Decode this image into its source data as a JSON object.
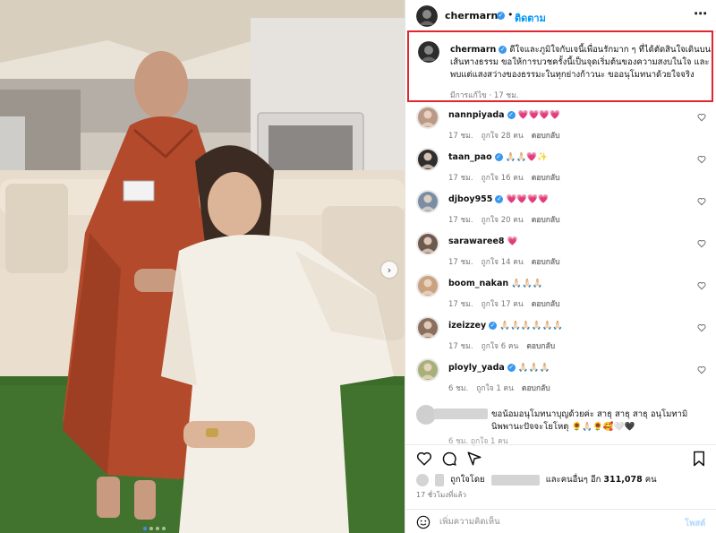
{
  "header": {
    "username": "chermarn",
    "separator": "•",
    "follow_label": "ติดตาม",
    "more_label": "⋯"
  },
  "caption": {
    "username": "chermarn",
    "text": "ดีใจและภูมิใจกับเจนี้เพื่อนรักมาก ๆ ที่ได้ตัดสินใจเดินบนเส้นทางธรรม ขอให้การบวชครั้งนี้เป็นจุดเริ่มต้นของความสงบในใจ และพบแต่แสงสว่างของธรรมะในทุกย่างก้าวนะ ขออนุโมทนาด้วยใจจริง",
    "meta": "มีการแก้ไข · 17 ชม."
  },
  "comments": [
    {
      "username": "nannpiyada",
      "verified": true,
      "text": "💗💗💗💗",
      "time": "17 ชม.",
      "likes": "ถูกใจ 28 คน",
      "reply": "ตอบกลับ",
      "avatar_color": "#b99a86"
    },
    {
      "username": "taan_pao",
      "verified": true,
      "text": "🙏🏻🙏🏻💗✨",
      "time": "17 ชม.",
      "likes": "ถูกใจ 16 คน",
      "reply": "ตอบกลับ",
      "avatar_color": "#2e2e2e"
    },
    {
      "username": "djboy955",
      "verified": true,
      "text": "💗💗💗💗",
      "time": "17 ชม.",
      "likes": "ถูกใจ 20 คน",
      "reply": "ตอบกลับ",
      "avatar_color": "#7a8ea3"
    },
    {
      "username": "sarawaree8",
      "verified": false,
      "text": "💗",
      "time": "17 ชม.",
      "likes": "ถูกใจ 14 คน",
      "reply": "ตอบกลับ",
      "avatar_color": "#6d5a4f"
    },
    {
      "username": "boom_nakan",
      "verified": false,
      "text": "🙏🏻🙏🏻🙏🏻",
      "time": "17 ชม.",
      "likes": "ถูกใจ 17 คน",
      "reply": "ตอบกลับ",
      "avatar_color": "#c9a27f"
    },
    {
      "username": "izeizzey",
      "verified": true,
      "text": "🙏🏻🙏🏻🙏🏻🙏🏻🙏🏻🙏🏻",
      "time": "17 ชม.",
      "likes": "ถูกใจ 6 คน",
      "reply": "ตอบกลับ",
      "avatar_color": "#8b6f5e"
    },
    {
      "username": "ployly_yada",
      "verified": true,
      "text": "🙏🏻🙏🏻🙏🏻",
      "time": "6 ชม.",
      "likes": "ถูกใจ 1 คน",
      "reply": "ตอบกลับ",
      "avatar_color": "#a8b07a"
    }
  ],
  "hidden_comment": {
    "text": "ขอน้อมอนุโมทนาบุญด้วยค่ะ สาธุ สาธุ สาธุ อนุโมทามิ นิพพานะปัจจะโยโหตุ 🌻🙏🏻🌻🥰🤍🖤",
    "time": "6 ชม. ถูกใจ 1 คน"
  },
  "actions": {
    "like_icon": "heart-outline-icon",
    "comment_icon": "comment-bubble-icon",
    "share_icon": "paper-plane-icon",
    "save_icon": "bookmark-icon"
  },
  "likes": {
    "prefix": "ถูกใจโดย",
    "middle": "และคนอื่นๆ อีก",
    "count": "311,078",
    "suffix": "คน"
  },
  "post_time": "17 ชั่วโมงที่แล้ว",
  "add_comment": {
    "placeholder": "เพิ่มความคิดเห็น",
    "post_label": "โพสต์",
    "emoji_icon": "smiley-icon"
  },
  "photo": {
    "next_label": "›",
    "slide_count": 4,
    "current_slide": 1
  }
}
